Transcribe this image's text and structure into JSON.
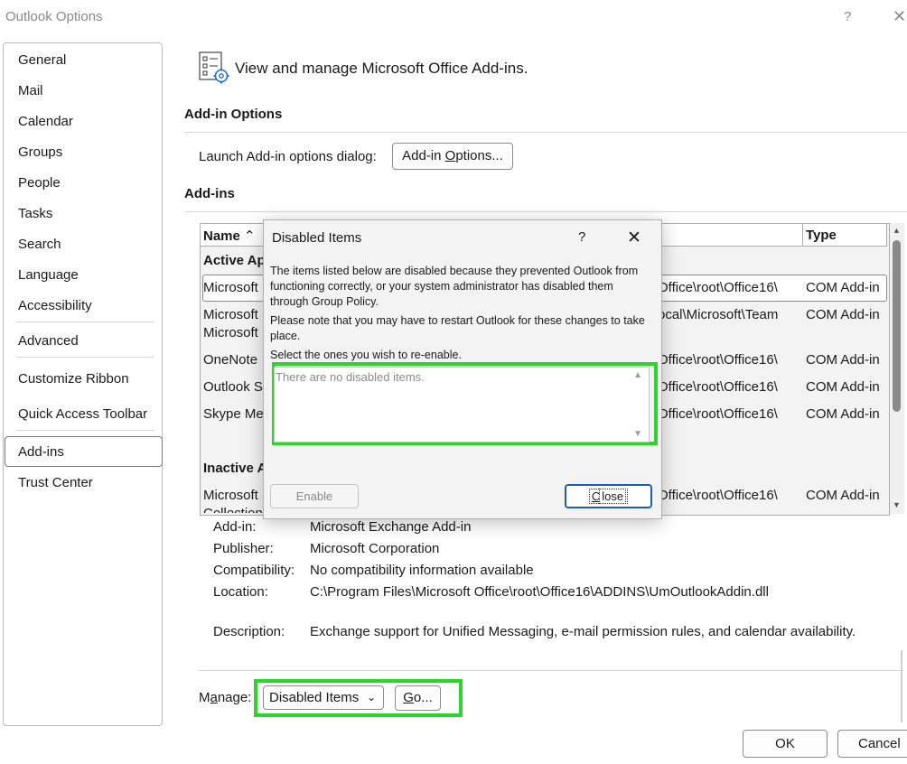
{
  "window": {
    "title": "Outlook Options",
    "help": "?",
    "close": "✕"
  },
  "sidebar": {
    "items": [
      {
        "label": "General"
      },
      {
        "label": "Mail"
      },
      {
        "label": "Calendar"
      },
      {
        "label": "Groups"
      },
      {
        "label": "People"
      },
      {
        "label": "Tasks"
      },
      {
        "label": "Search"
      },
      {
        "label": "Language"
      },
      {
        "label": "Accessibility"
      },
      {
        "label": "Advanced"
      },
      {
        "label": "Customize Ribbon"
      },
      {
        "label": "Quick Access Toolbar"
      },
      {
        "label": "Add-ins",
        "selected": true
      },
      {
        "label": "Trust Center"
      }
    ]
  },
  "header": {
    "title": "View and manage Microsoft Office Add-ins."
  },
  "addin_options": {
    "section_title": "Add-in Options",
    "launch_label": "Launch Add-in options dialog:",
    "button_pre": "Add-in ",
    "button_accel": "O",
    "button_post": "ptions..."
  },
  "addins": {
    "section_title": "Add-ins",
    "columns": {
      "name": "Name",
      "sort": "⌃",
      "type": "Type"
    },
    "groups": {
      "active": "Active Ap",
      "inactive": "Inactive A"
    },
    "rows": [
      {
        "name": "Microsoft",
        "location": "Office\\root\\Office16\\",
        "type": "COM Add-in"
      },
      {
        "name": "Microsoft",
        "name2": "Microsoft",
        "location": "ocal\\Microsoft\\Team",
        "type": "COM Add-in"
      },
      {
        "name": "OneNote",
        "location": "Office\\root\\Office16\\",
        "type": "COM Add-in"
      },
      {
        "name": "Outlook S",
        "location": "Office\\root\\Office16\\",
        "type": "COM Add-in"
      },
      {
        "name": "Skype Mee",
        "location": "Office\\root\\Office16\\",
        "type": "COM Add-in"
      },
      {
        "name": "Microsoft",
        "name2": "Collection",
        "location": "Office\\root\\Office16\\",
        "type": "COM Add-in"
      }
    ]
  },
  "details": {
    "addin": {
      "label": "Add-in:",
      "value": "Microsoft Exchange Add-in"
    },
    "publisher": {
      "label": "Publisher:",
      "value": "Microsoft Corporation"
    },
    "compatibility": {
      "label": "Compatibility:",
      "value": "No compatibility information available"
    },
    "location": {
      "label": "Location:",
      "value": "C:\\Program Files\\Microsoft Office\\root\\Office16\\ADDINS\\UmOutlookAddin.dll"
    },
    "description": {
      "label": "Description:",
      "value": "Exchange support for Unified Messaging, e-mail permission rules, and calendar availability."
    }
  },
  "manage": {
    "label_pre": "M",
    "label_accel": "a",
    "label_post": "nage:",
    "selected": "Disabled Items",
    "go_accel": "G",
    "go_post": "o..."
  },
  "footer": {
    "ok": "OK",
    "cancel": "Cancel"
  },
  "dialog": {
    "title": "Disabled Items",
    "help": "?",
    "close": "✕",
    "para1": "The items listed below are disabled because they prevented Outlook from functioning correctly, or your system administrator has disabled them through Group Policy.",
    "para2": "Please note that you may have to restart Outlook for these changes to take place.",
    "para3": "Select the ones you wish to re-enable.",
    "empty": "There are no disabled items.",
    "enable": "Enable",
    "close_accel": "C",
    "close_post": "lose"
  },
  "colors": {
    "highlight": "#2ad628",
    "focus": "#1f5db5"
  }
}
